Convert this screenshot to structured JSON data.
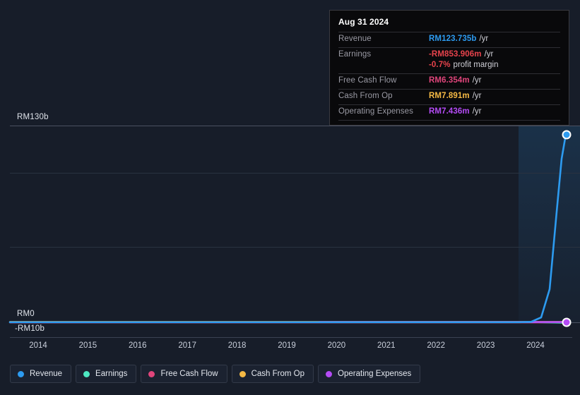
{
  "tooltip": {
    "date": "Aug 31 2024",
    "rows": [
      {
        "label": "Revenue",
        "value": "RM123.735b",
        "unit": "/yr",
        "color": "#2d9bf0"
      },
      {
        "label": "Earnings",
        "value": "-RM853.906m",
        "unit": "/yr",
        "color": "#e8434c"
      },
      {
        "label": "",
        "value": "-0.7%",
        "unit": "profit margin",
        "color": "#e8434c",
        "sub": true
      },
      {
        "label": "Free Cash Flow",
        "value": "RM6.354m",
        "unit": "/yr",
        "color": "#e0457b"
      },
      {
        "label": "Cash From Op",
        "value": "RM7.891m",
        "unit": "/yr",
        "color": "#f5b944"
      },
      {
        "label": "Operating Expenses",
        "value": "RM7.436m",
        "unit": "/yr",
        "color": "#b44bf5"
      }
    ]
  },
  "legend": [
    {
      "label": "Revenue",
      "color": "#2d9bf0"
    },
    {
      "label": "Earnings",
      "color": "#4de8c2"
    },
    {
      "label": "Free Cash Flow",
      "color": "#e0457b"
    },
    {
      "label": "Cash From Op",
      "color": "#f5b944"
    },
    {
      "label": "Operating Expenses",
      "color": "#b44bf5"
    }
  ],
  "axis": {
    "y_top": "RM130b",
    "y_zero": "RM0",
    "y_bottom": "-RM10b",
    "x_ticks": [
      "2014",
      "2015",
      "2016",
      "2017",
      "2018",
      "2019",
      "2020",
      "2021",
      "2022",
      "2023",
      "2024"
    ]
  },
  "chart_data": {
    "type": "line",
    "title": "",
    "xlabel": "",
    "ylabel": "",
    "currency": "RM",
    "ylim": [
      -10000000000,
      130000000000
    ],
    "ytick_values": [
      130000000000,
      0,
      -10000000000
    ],
    "ytick_labels": [
      "RM130b",
      "RM0",
      "-RM10b"
    ],
    "gridlines": [
      130000000000,
      87000000000,
      44000000000,
      0
    ],
    "grid": true,
    "legend_position": "bottom",
    "forecast_start": "2023.6",
    "x": [
      "2014",
      "2015",
      "2016",
      "2017",
      "2018",
      "2019",
      "2020",
      "2021",
      "2022",
      "2023",
      "2024"
    ],
    "series": [
      {
        "name": "Revenue",
        "color": "#2d9bf0",
        "end_marker": true,
        "end_value_label": "RM123.735b",
        "values": [
          0,
          0,
          0,
          0,
          0,
          0,
          0,
          0,
          0,
          0.2,
          123.735
        ],
        "units": "billions RM"
      },
      {
        "name": "Earnings",
        "color": "#4de8c2",
        "end_marker": false,
        "end_value_label": "-RM853.906m",
        "values": [
          0,
          0,
          0,
          0,
          0,
          0,
          0,
          0,
          0,
          0,
          -0.854
        ],
        "units": "billions RM"
      },
      {
        "name": "Free Cash Flow",
        "color": "#e0457b",
        "end_marker": false,
        "end_value_label": "RM6.354m",
        "values": [
          0,
          0,
          0,
          0,
          0,
          0,
          0,
          0,
          0,
          0,
          0.006
        ],
        "units": "billions RM"
      },
      {
        "name": "Cash From Op",
        "color": "#f5b944",
        "end_marker": false,
        "end_value_label": "RM7.891m",
        "values": [
          0,
          0,
          0,
          0,
          0,
          0,
          0,
          0,
          0,
          0,
          0.008
        ],
        "units": "billions RM"
      },
      {
        "name": "Operating Expenses",
        "color": "#b44bf5",
        "end_marker": true,
        "end_value_label": "RM7.436m",
        "values": [
          0,
          0,
          0,
          0,
          0,
          0,
          0,
          0,
          0,
          0,
          0.007
        ],
        "units": "billions RM"
      }
    ]
  }
}
